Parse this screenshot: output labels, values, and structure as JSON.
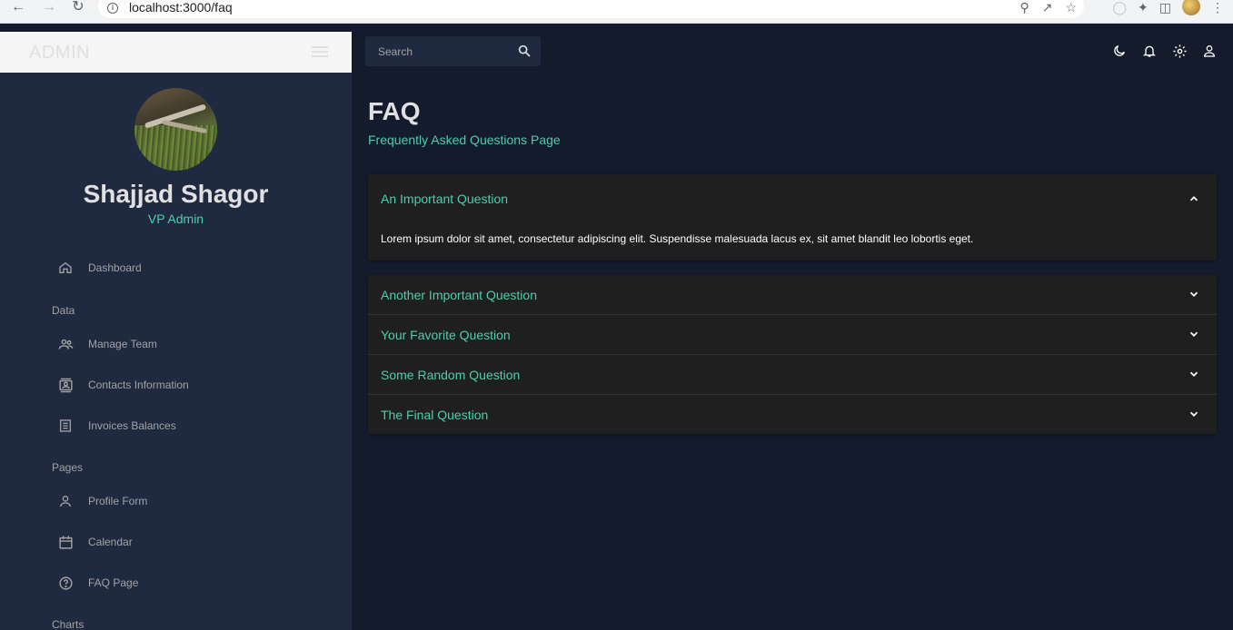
{
  "browser": {
    "url": "localhost:3000/faq"
  },
  "sidebar": {
    "brand": "ADMIN",
    "profile": {
      "name": "Shajjad Shagor",
      "role": "VP Admin"
    },
    "items": [
      {
        "label": "Dashboard",
        "icon": "home-icon"
      },
      {
        "label": "Manage Team",
        "icon": "people-icon"
      },
      {
        "label": "Contacts Information",
        "icon": "contacts-icon"
      },
      {
        "label": "Invoices Balances",
        "icon": "receipt-icon"
      },
      {
        "label": "Profile Form",
        "icon": "person-icon"
      },
      {
        "label": "Calendar",
        "icon": "calendar-icon"
      },
      {
        "label": "FAQ Page",
        "icon": "help-icon"
      }
    ],
    "sections": [
      "Data",
      "Pages",
      "Charts"
    ]
  },
  "topbar": {
    "search_placeholder": "Search"
  },
  "page": {
    "title": "FAQ",
    "subtitle": "Frequently Asked Questions Page"
  },
  "faq": [
    {
      "question": "An Important Question",
      "answer": "Lorem ipsum dolor sit amet, consectetur adipiscing elit. Suspendisse malesuada lacus ex, sit amet blandit leo lobortis eget.",
      "expanded": true
    },
    {
      "question": "Another Important Question",
      "expanded": false
    },
    {
      "question": "Your Favorite Question",
      "expanded": false
    },
    {
      "question": "Some Random Question",
      "expanded": false
    },
    {
      "question": "The Final Question",
      "expanded": false
    }
  ],
  "colors": {
    "background": "#141b2d",
    "panel": "#1f2a40",
    "accent": "#4cceac",
    "accordion": "#1f1f1f"
  }
}
